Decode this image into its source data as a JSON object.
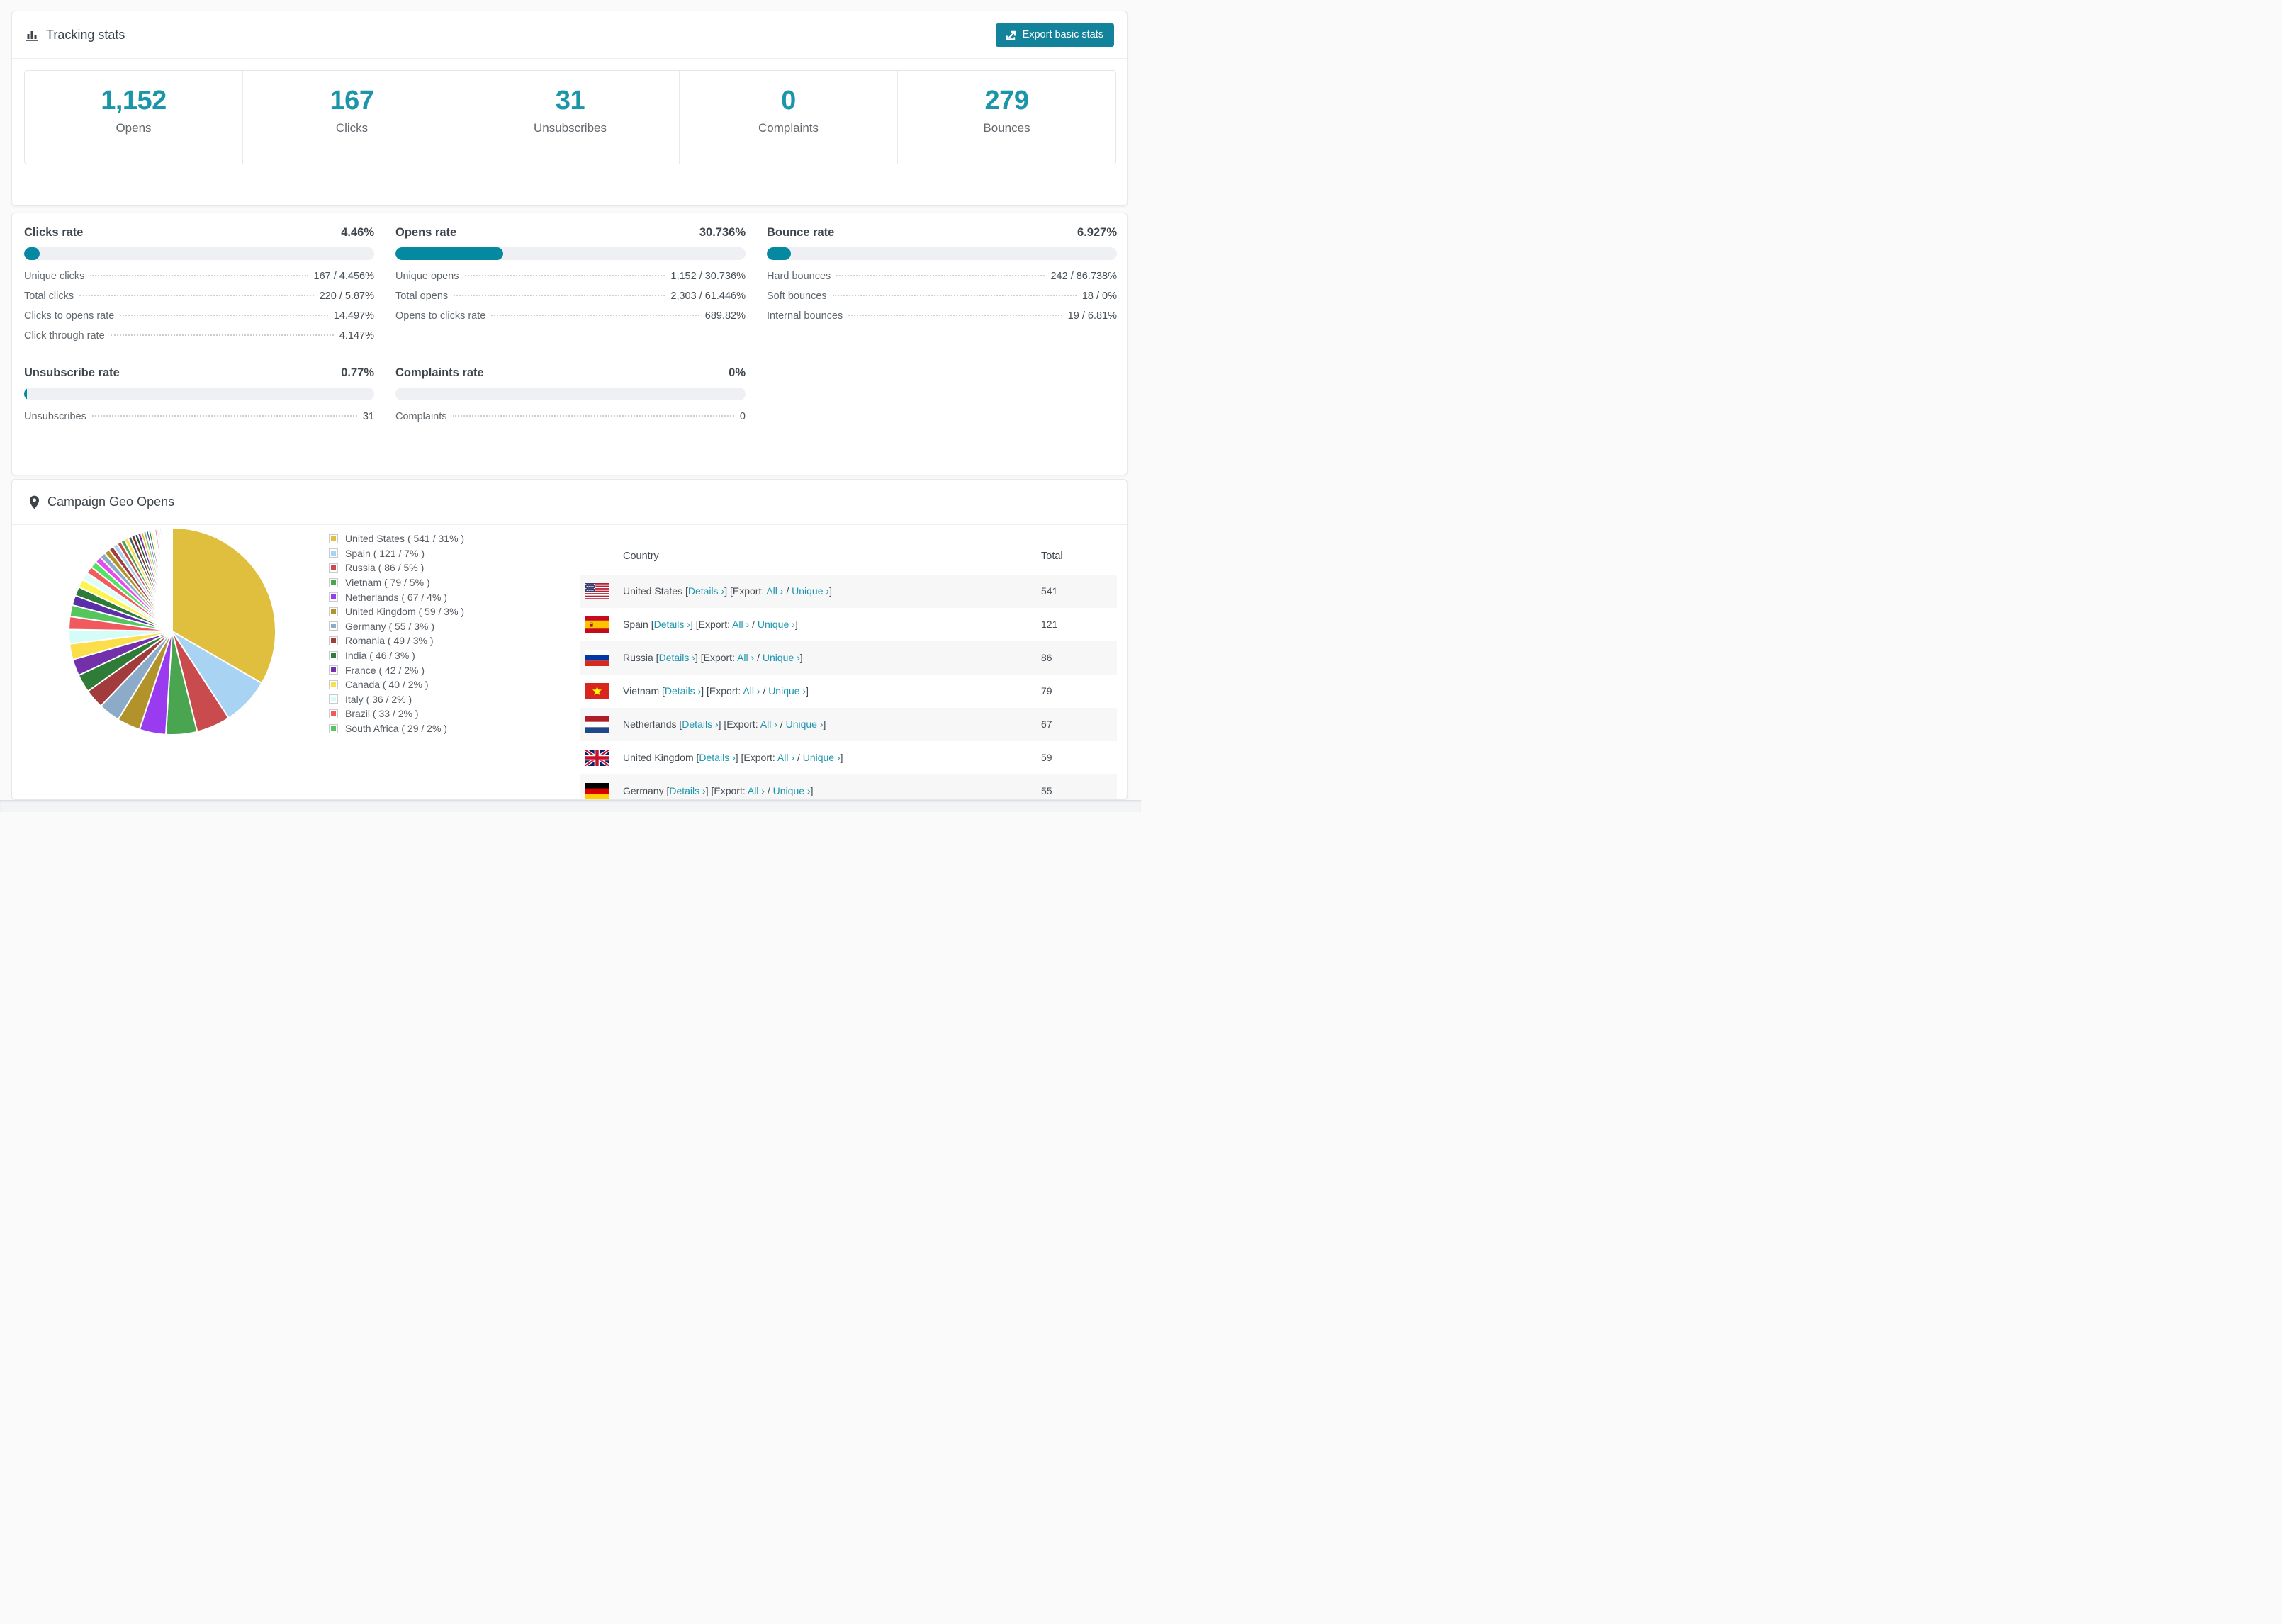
{
  "colors": {
    "accent_teal": "#1b95aa",
    "button_teal": "#12839a",
    "bar_fill": "#0489a0",
    "link_teal": "#1d96ad",
    "bar_track": "#eef0f3",
    "stripe": "#f7f7f8"
  },
  "tracking": {
    "title": "Tracking stats",
    "export_button": "Export basic stats",
    "stats": [
      {
        "value": "1,152",
        "label": "Opens"
      },
      {
        "value": "167",
        "label": "Clicks"
      },
      {
        "value": "31",
        "label": "Unsubscribes"
      },
      {
        "value": "0",
        "label": "Complaints"
      },
      {
        "value": "279",
        "label": "Bounces"
      }
    ]
  },
  "rates": {
    "panels": [
      {
        "title": "Clicks rate",
        "value": "4.46%",
        "percent": 4.46,
        "grid": {
          "row": 0,
          "col": 0
        },
        "rows": [
          [
            "Unique clicks",
            "167 / 4.456%"
          ],
          [
            "Total clicks",
            "220 / 5.87%"
          ],
          [
            "Clicks to opens rate",
            "14.497%"
          ],
          [
            "Click through rate",
            "4.147%"
          ]
        ]
      },
      {
        "title": "Opens rate",
        "value": "30.736%",
        "percent": 30.736,
        "grid": {
          "row": 0,
          "col": 1
        },
        "rows": [
          [
            "Unique opens",
            "1,152 / 30.736%"
          ],
          [
            "Total opens",
            "2,303 / 61.446%"
          ],
          [
            "Opens to clicks rate",
            "689.82%"
          ]
        ]
      },
      {
        "title": "Bounce rate",
        "value": "6.927%",
        "percent": 6.927,
        "grid": {
          "row": 0,
          "col": 2
        },
        "rows": [
          [
            "Hard bounces",
            "242 / 86.738%"
          ],
          [
            "Soft bounces",
            "18 / 0%"
          ],
          [
            "Internal bounces",
            "19 / 6.81%"
          ]
        ]
      },
      {
        "title": "Unsubscribe rate",
        "value": "0.77%",
        "percent": 0.77,
        "grid": {
          "row": 1,
          "col": 0
        },
        "rows": [
          [
            "Unsubscribes",
            "31"
          ]
        ]
      },
      {
        "title": "Complaints rate",
        "value": "0%",
        "percent": 0,
        "grid": {
          "row": 1,
          "col": 1
        },
        "rows": [
          [
            "Complaints",
            "0"
          ]
        ]
      }
    ]
  },
  "geo": {
    "title": "Campaign Geo Opens",
    "columns": {
      "country": "Country",
      "total": "Total"
    },
    "row_format": {
      "b_open": " [",
      "details": "Details ›",
      "b_mid": "] [",
      "export_label": "Export:",
      "all": "All ›",
      "slash": " / ",
      "unique": "Unique ›",
      "b_close": "]"
    },
    "rows": [
      {
        "country": "United States",
        "flag": "us",
        "total": "541"
      },
      {
        "country": "Spain",
        "flag": "es",
        "total": "121"
      },
      {
        "country": "Russia",
        "flag": "ru",
        "total": "86"
      },
      {
        "country": "Vietnam",
        "flag": "vn",
        "total": "79"
      },
      {
        "country": "Netherlands",
        "flag": "nl",
        "total": "67"
      },
      {
        "country": "United Kingdom",
        "flag": "gb",
        "total": "59"
      },
      {
        "country": "Germany",
        "flag": "de",
        "total": "55"
      }
    ]
  },
  "chart_data": {
    "type": "pie",
    "title": "Campaign Geo Opens",
    "unit": "opens",
    "start_angle_deg": -90,
    "direction": "clockwise",
    "legend_position": "right",
    "legend_format": "{name} ( {value} / {pct}% )",
    "series": [
      {
        "name": "United States",
        "value": 541,
        "pct": 31,
        "color": "#e0be3e"
      },
      {
        "name": "Spain",
        "value": 121,
        "pct": 7,
        "color": "#a8d3f2"
      },
      {
        "name": "Russia",
        "value": 86,
        "pct": 5,
        "color": "#c94b4e"
      },
      {
        "name": "Vietnam",
        "value": 79,
        "pct": 5,
        "color": "#4aa551"
      },
      {
        "name": "Netherlands",
        "value": 67,
        "pct": 4,
        "color": "#9b3bf0"
      },
      {
        "name": "United Kingdom",
        "value": 59,
        "pct": 3,
        "color": "#b2932b"
      },
      {
        "name": "Germany",
        "value": 55,
        "pct": 3,
        "color": "#8cabc9"
      },
      {
        "name": "Romania",
        "value": 49,
        "pct": 3,
        "color": "#a23c3c"
      },
      {
        "name": "India",
        "value": 46,
        "pct": 3,
        "color": "#2f7c39"
      },
      {
        "name": "France",
        "value": 42,
        "pct": 2,
        "color": "#7230ab"
      },
      {
        "name": "Canada",
        "value": 40,
        "pct": 2,
        "color": "#fadf4b"
      },
      {
        "name": "Italy",
        "value": 36,
        "pct": 2,
        "color": "#d6fcf8"
      },
      {
        "name": "Brazil",
        "value": 33,
        "pct": 2,
        "color": "#f05a5e"
      },
      {
        "name": "South Africa",
        "value": 29,
        "pct": 2,
        "color": "#55c55e"
      }
    ],
    "others_unlabeled": {
      "values": [
        25,
        23,
        21,
        20,
        18,
        17,
        16,
        15,
        14,
        13,
        12,
        11,
        10,
        10,
        9,
        9,
        8,
        8,
        7,
        7,
        6,
        6,
        5,
        5,
        5,
        4,
        4,
        4,
        3,
        3,
        3,
        3,
        2,
        2,
        2,
        2,
        2,
        1,
        1,
        1,
        1,
        1
      ],
      "palette": [
        "#5b2fa8",
        "#2f7c39",
        "#fdf452",
        "#dffdf9",
        "#f4595e",
        "#55e066",
        "#e44cf0",
        "#8cabc9",
        "#b2932b",
        "#a23c3c",
        "#a8d3f2",
        "#c94b4e",
        "#4aa551",
        "#fadf4b",
        "#455a64",
        "#7a2e2e",
        "#1e5631",
        "#7230ab",
        "#f0b429",
        "#66bb6a"
      ]
    }
  }
}
